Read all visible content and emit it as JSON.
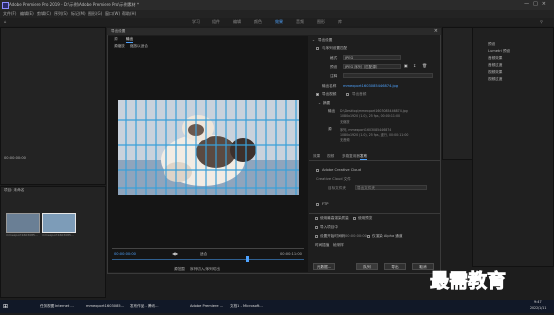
{
  "app": {
    "window_title": "Adobe Premiere Pro 2019 - D:\\示例\\Adobe Premiere Pro\\示例素材 *"
  },
  "menubar": [
    "文件(F)",
    "编辑(E)",
    "剪辑(C)",
    "序列(S)",
    "标记(M)",
    "图形(G)",
    "窗口(W)",
    "帮助(H)"
  ],
  "workspaces": {
    "items": [
      "学习",
      "组件",
      "编辑",
      "颜色",
      "效果",
      "音频",
      "图形",
      "库"
    ],
    "active_index": 4
  },
  "dialog": {
    "title": "导出设置",
    "left_tabs": [
      "源",
      "输出"
    ],
    "source_scaling_label": "源缩放",
    "source_scaling_value": "缩放以适合",
    "timecode_start": "00:00:00:00",
    "timecode_end": "00:00:11:00",
    "source_range_label": "源范围",
    "source_range_value": "序列切入/序列切出",
    "fit_label": "适合",
    "export_settings": {
      "header": "导出设置",
      "match_sequence_label": "与序列设置匹配",
      "format_label": "格式",
      "format_value": "JPEG",
      "preset_label": "预设",
      "preset_value": "JPEG 序列（匹配源）",
      "comments_label": "注释",
      "output_name_label": "输出名称",
      "output_name_value": "mmexport1603085446874.jpg",
      "export_video_label": "导出视频",
      "export_audio_label": "导出音频",
      "summary_label": "摘要",
      "summary_output_label": "输出",
      "summary_output_text": "D:\\Desktop\\mmexport1603085446874.jpg",
      "summary_output_detail": "1080x1920 (1.0), 25 fps, 00:00:11:00",
      "summary_output_extra": "无缩放",
      "summary_source_label": "源",
      "summary_source_text": "序列, mmexport1603085446874",
      "summary_source_detail": "1080x1920 (1.0), 25 fps, 逐行, 00:00:11:00",
      "summary_source_extra": "无音频"
    },
    "settings_tabs": [
      "效果",
      "视频",
      "多路复用器",
      "发布"
    ],
    "settings_active_index": 3,
    "publish": {
      "adobe_cc_label": "Adobe Creative Cloud",
      "cc_files_label": "Creative Cloud 文件",
      "target_folder_label": "目标文件夹",
      "target_folder_value": "导出文件夹",
      "ftp_label": "FTP"
    },
    "options": {
      "max_render_quality": "使用最高渲染质量",
      "use_previews": "使用预览",
      "import_into_project": "导入项目中",
      "set_start_timecode": "设置开始时间码",
      "start_timecode_value": "00:00:00:00",
      "render_alpha_only": "仅渲染 Alpha 通道",
      "time_interpolation_label": "时间插值",
      "time_interpolation_value": "帧采样"
    },
    "buttons": {
      "metadata": "元数据...",
      "queue": "队列",
      "export": "导出",
      "cancel": "取消"
    }
  },
  "background": {
    "program_timecode_left": "00:00:00:00",
    "program_timecode_right": "00:00:11:00",
    "project_items": [
      "mmexport1603085...",
      "mmexport1603085..."
    ],
    "project_tab": "项目: 未命名",
    "effects_list": [
      "预设",
      "Lumetri 预设",
      "音频效果",
      "音频过渡",
      "视频效果",
      "视频过渡"
    ]
  },
  "taskbar": {
    "items": [
      "任务视图",
      "Internet ...",
      "mmexport1603085...",
      "发布作品 - 腾讯...",
      "",
      "Adobe Premiere ...",
      "文档1 - Microsoft..."
    ],
    "time": "9:47",
    "date": "2022/1/11"
  },
  "watermark": {
    "text": "最需教育"
  },
  "colors": {
    "accent": "#4ea3ff",
    "watermark": "#1a54d6",
    "cage": "#3aa0d8"
  }
}
